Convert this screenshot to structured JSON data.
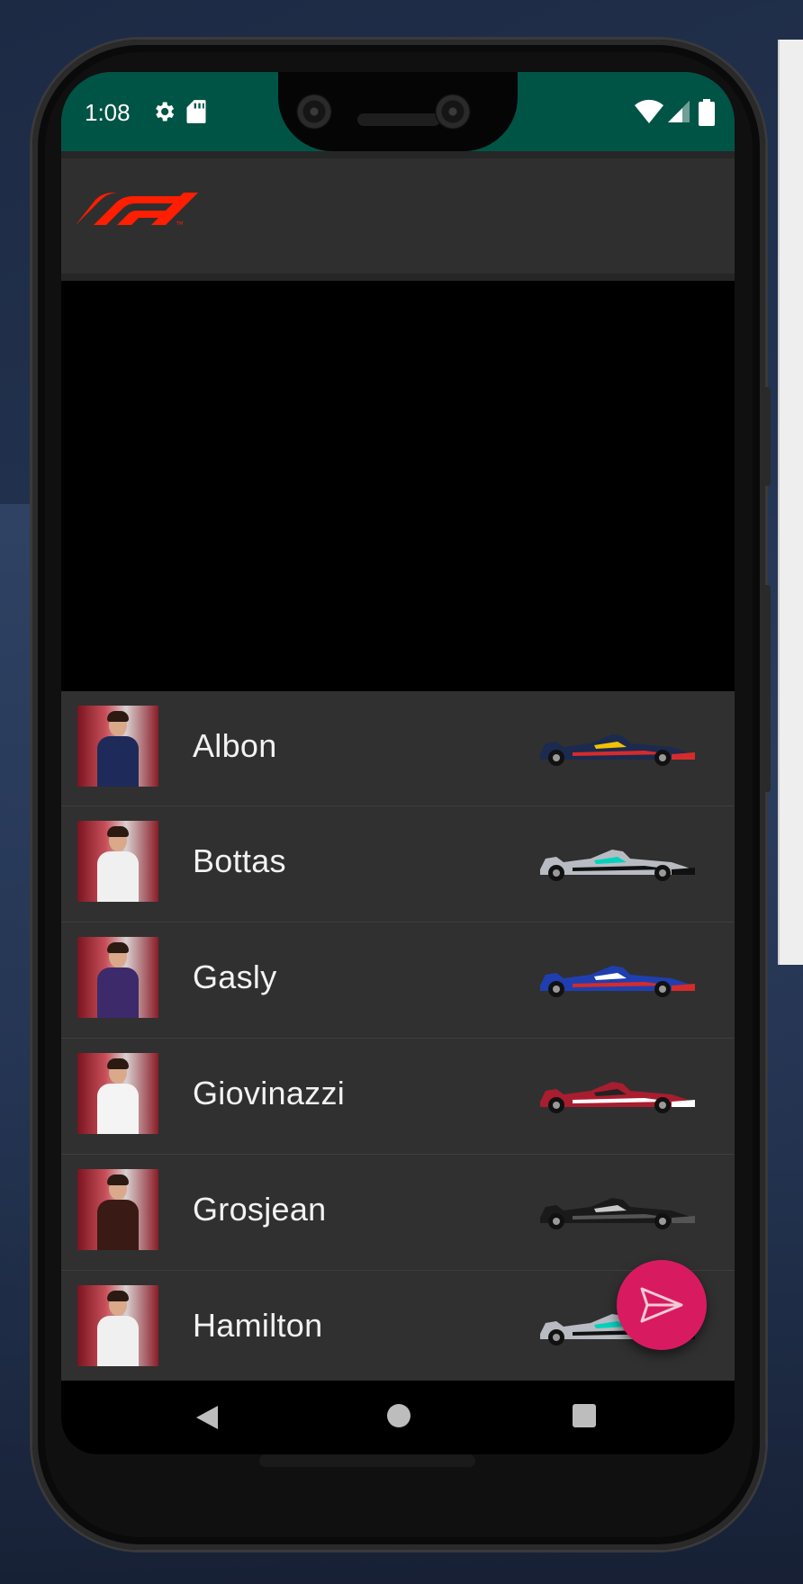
{
  "status_bar": {
    "time": "1:08",
    "icons": [
      "gear-icon",
      "sd-card-icon",
      "wifi-icon",
      "signal-icon",
      "battery-icon"
    ],
    "color": "#005446"
  },
  "app_bar": {
    "logo": "f1-logo",
    "logo_color": "#ff1e00"
  },
  "drivers": [
    {
      "name": "Albon",
      "suit_color": "#1e2a5a",
      "car_colors": [
        "#1b2a4e",
        "#d62b2b",
        "#f2c200"
      ]
    },
    {
      "name": "Bottas",
      "suit_color": "#f0f0f0",
      "car_colors": [
        "#b8bcc2",
        "#111111",
        "#00d2be"
      ]
    },
    {
      "name": "Gasly",
      "suit_color": "#3c2a6a",
      "car_colors": [
        "#1f3fb0",
        "#d62b2b",
        "#ffffff"
      ]
    },
    {
      "name": "Giovinazzi",
      "suit_color": "#f4f4f4",
      "car_colors": [
        "#a81d2f",
        "#ffffff",
        "#222222"
      ]
    },
    {
      "name": "Grosjean",
      "suit_color": "#3a1a14",
      "car_colors": [
        "#1a1a1a",
        "#555555",
        "#c8c8c8"
      ]
    },
    {
      "name": "Hamilton",
      "suit_color": "#f0f0f0",
      "car_colors": [
        "#b8bcc2",
        "#111111",
        "#00d2be"
      ]
    }
  ],
  "fab": {
    "icon": "send-icon",
    "color": "#d81b60"
  },
  "nav": {
    "icons": [
      "back-icon",
      "home-icon",
      "recents-icon"
    ]
  }
}
